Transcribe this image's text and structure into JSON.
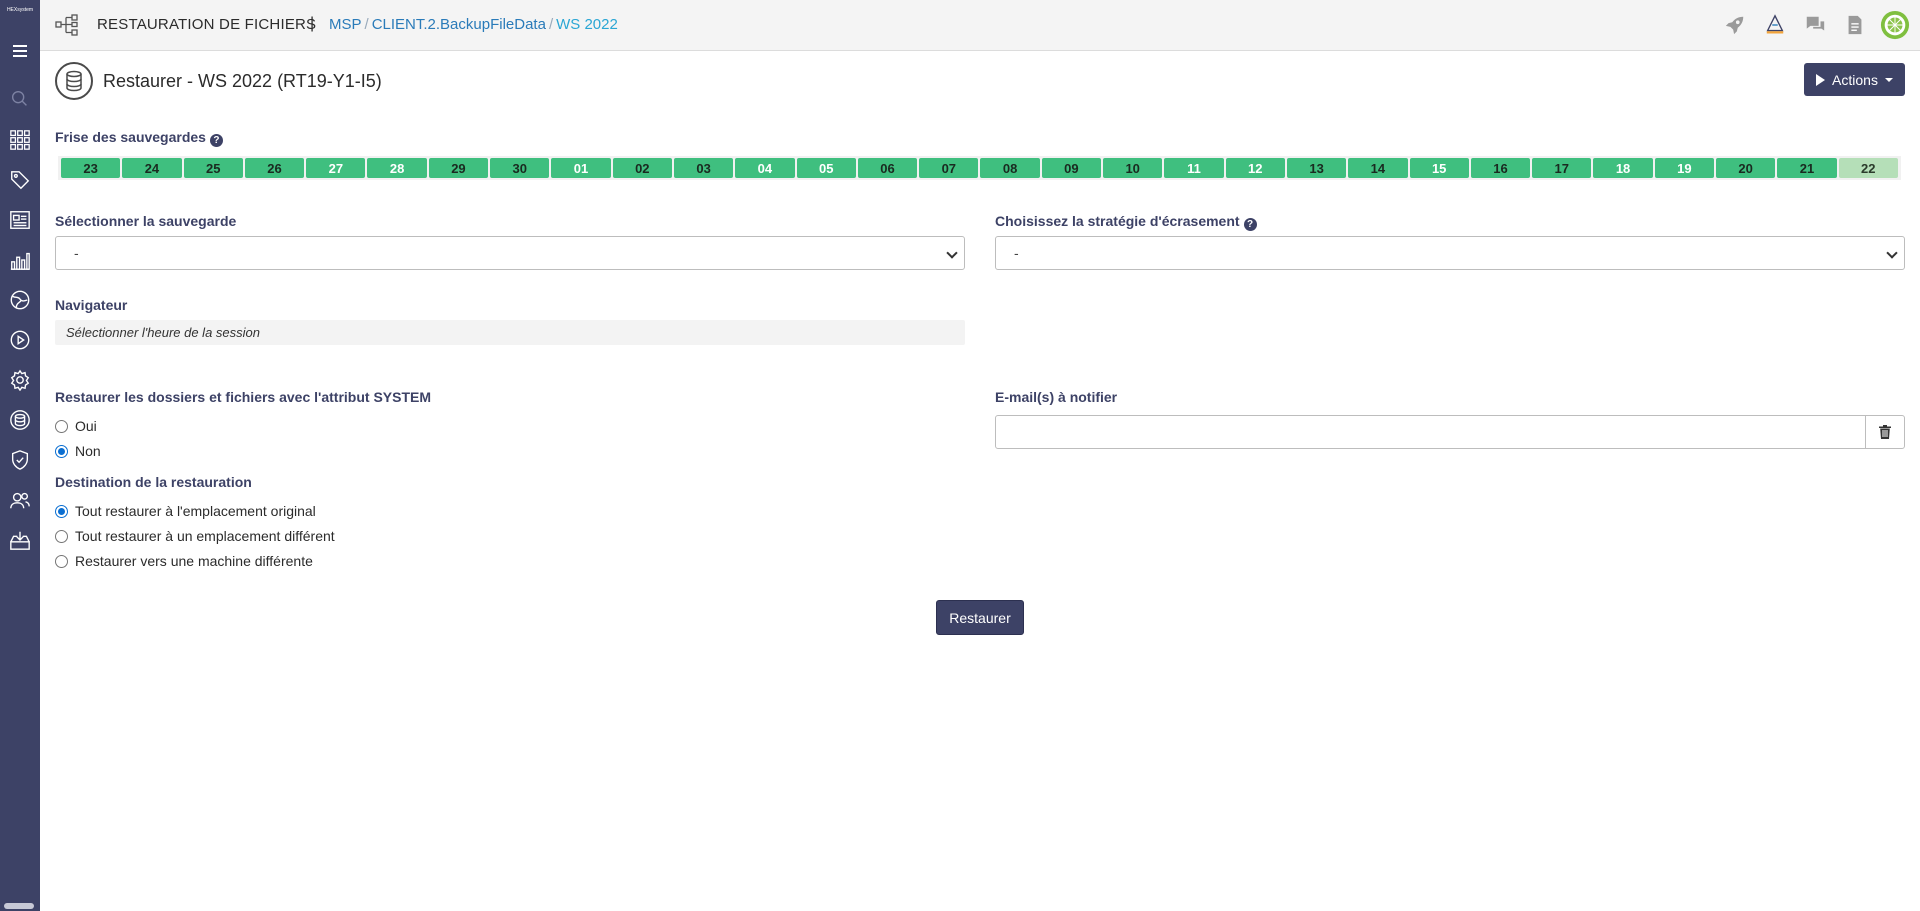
{
  "sidebar": {
    "logo_text": "HEXsystem",
    "items": [
      {
        "icon": "search-icon"
      },
      {
        "icon": "grid-icon"
      },
      {
        "icon": "tags-icon"
      },
      {
        "icon": "news-icon"
      },
      {
        "icon": "bar-chart-icon"
      },
      {
        "icon": "globe-icon"
      },
      {
        "icon": "play-circle-icon"
      },
      {
        "icon": "gear-icon"
      },
      {
        "icon": "database-icon"
      },
      {
        "icon": "shield-icon"
      },
      {
        "icon": "users-icon"
      },
      {
        "icon": "inbox-download-icon"
      }
    ]
  },
  "header": {
    "title": "RESTAURATION DE FICHIERS",
    "separator": "|",
    "breadcrumb": [
      "MSP",
      "CLIENT.2.BackupFileData",
      "WS 2022"
    ],
    "right_icons": [
      "rocket-icon",
      "pen-tool-icon",
      "chat-icon",
      "document-icon",
      "avatar"
    ]
  },
  "page": {
    "title": "Restaurer - WS 2022 (RT19-Y1-I5)",
    "actions_label": "Actions"
  },
  "timeline": {
    "label": "Frise des sauvegardes",
    "help": "?",
    "days": [
      {
        "label": "23",
        "status": "ok"
      },
      {
        "label": "24",
        "status": "ok"
      },
      {
        "label": "25",
        "status": "ok"
      },
      {
        "label": "26",
        "status": "ok"
      },
      {
        "label": "27",
        "status": "ok-light"
      },
      {
        "label": "28",
        "status": "ok-light"
      },
      {
        "label": "29",
        "status": "ok"
      },
      {
        "label": "30",
        "status": "ok"
      },
      {
        "label": "01",
        "status": "ok-light"
      },
      {
        "label": "02",
        "status": "ok"
      },
      {
        "label": "03",
        "status": "ok"
      },
      {
        "label": "04",
        "status": "ok-light"
      },
      {
        "label": "05",
        "status": "ok-light"
      },
      {
        "label": "06",
        "status": "ok"
      },
      {
        "label": "07",
        "status": "ok"
      },
      {
        "label": "08",
        "status": "ok"
      },
      {
        "label": "09",
        "status": "ok"
      },
      {
        "label": "10",
        "status": "ok"
      },
      {
        "label": "11",
        "status": "ok-light"
      },
      {
        "label": "12",
        "status": "ok-light"
      },
      {
        "label": "13",
        "status": "ok"
      },
      {
        "label": "14",
        "status": "ok"
      },
      {
        "label": "15",
        "status": "ok-light"
      },
      {
        "label": "16",
        "status": "ok"
      },
      {
        "label": "17",
        "status": "ok"
      },
      {
        "label": "18",
        "status": "ok-light"
      },
      {
        "label": "19",
        "status": "ok-light"
      },
      {
        "label": "20",
        "status": "ok"
      },
      {
        "label": "21",
        "status": "ok"
      },
      {
        "label": "22",
        "status": "pale"
      }
    ]
  },
  "backup_select": {
    "label": "Sélectionner la sauvegarde",
    "value": "-"
  },
  "overwrite_select": {
    "label": "Choisissez la stratégie d'écrasement",
    "help": "?",
    "value": "-"
  },
  "navigator": {
    "label": "Navigateur",
    "placeholder": "Sélectionner l'heure de la session"
  },
  "system_attr": {
    "label": "Restaurer les dossiers et fichiers avec l'attribut SYSTEM",
    "options": [
      {
        "label": "Oui",
        "checked": false
      },
      {
        "label": "Non",
        "checked": true
      }
    ]
  },
  "destination": {
    "label": "Destination de la restauration",
    "options": [
      {
        "label": "Tout restaurer à l'emplacement original",
        "checked": true
      },
      {
        "label": "Tout restaurer à un emplacement différent",
        "checked": false
      },
      {
        "label": "Restaurer vers une machine différente",
        "checked": false
      }
    ]
  },
  "email": {
    "label": "E-mail(s) à notifier",
    "value": ""
  },
  "restore_button": "Restaurer",
  "colors": {
    "sidebar": "#3d4266",
    "primary": "#3d4266",
    "timeline_ok": "#3fbf7f",
    "timeline_pale": "#b5dfb8",
    "link": "#2a7bb9",
    "radio": "#0a6ed1"
  }
}
